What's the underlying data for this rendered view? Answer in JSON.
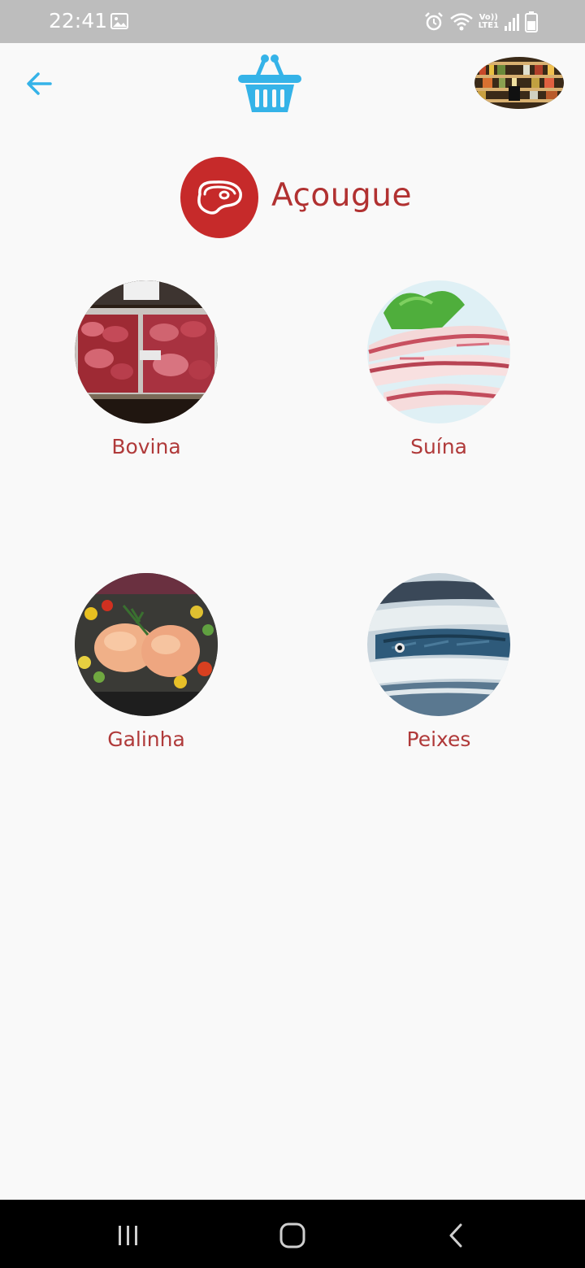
{
  "status_bar": {
    "time": "22:41",
    "volte_top": "Vo))",
    "volte_bottom": "LTE1",
    "icons": [
      "gallery-icon",
      "alarm-icon",
      "wifi-icon",
      "signal-icon",
      "battery-icon"
    ]
  },
  "app_bar": {
    "back_icon": "arrow-left-icon",
    "logo_icon": "basket-icon",
    "store_image": "store-shelves"
  },
  "category": {
    "title": "Açougue",
    "icon": "steak-icon",
    "badge_color": "#c62a2a"
  },
  "items": [
    {
      "label": "Bovina",
      "image": "beef-cuts"
    },
    {
      "label": "Suína",
      "image": "pork-belly"
    },
    {
      "label": "Galinha",
      "image": "roast-chicken"
    },
    {
      "label": "Peixes",
      "image": "fish"
    }
  ],
  "nav_bar": {
    "buttons": [
      "recents-icon",
      "home-icon",
      "back-icon"
    ]
  },
  "colors": {
    "accent": "#35b3e8",
    "title_red": "#b13131",
    "background": "#f9f9f9"
  }
}
